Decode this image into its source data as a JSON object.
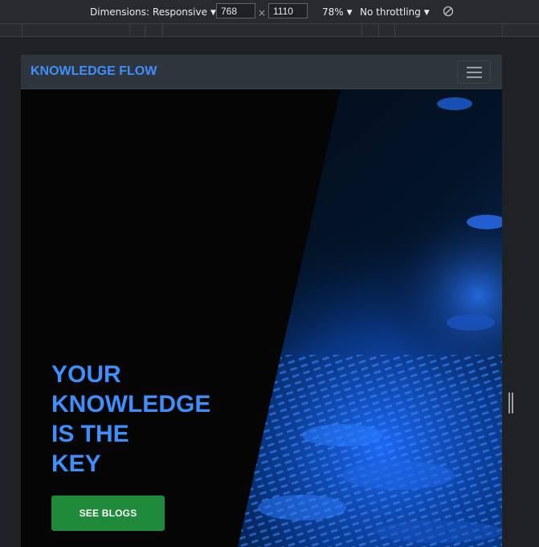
{
  "devtools": {
    "dimensions_label": "Dimensions: Responsive",
    "width_value": "768",
    "times_symbol": "×",
    "height_value": "1110",
    "zoom_label": "78%",
    "throttling_label": "No throttling",
    "caret": "▼"
  },
  "navbar": {
    "brand": "KNOWLEDGE FLOW"
  },
  "hero": {
    "headline_lines": [
      "YOUR",
      "KNOWLEDGE",
      "IS THE",
      "KEY"
    ],
    "cta_label": "SEE BLOGS"
  },
  "colors": {
    "brand_blue": "#3f8efc",
    "cta_green": "#1f8a3a",
    "navbar_bg": "#2f353c"
  },
  "icons": [
    "caret-down-icon",
    "rotate-icon",
    "hamburger-menu-icon",
    "resize-handle-icon"
  ]
}
